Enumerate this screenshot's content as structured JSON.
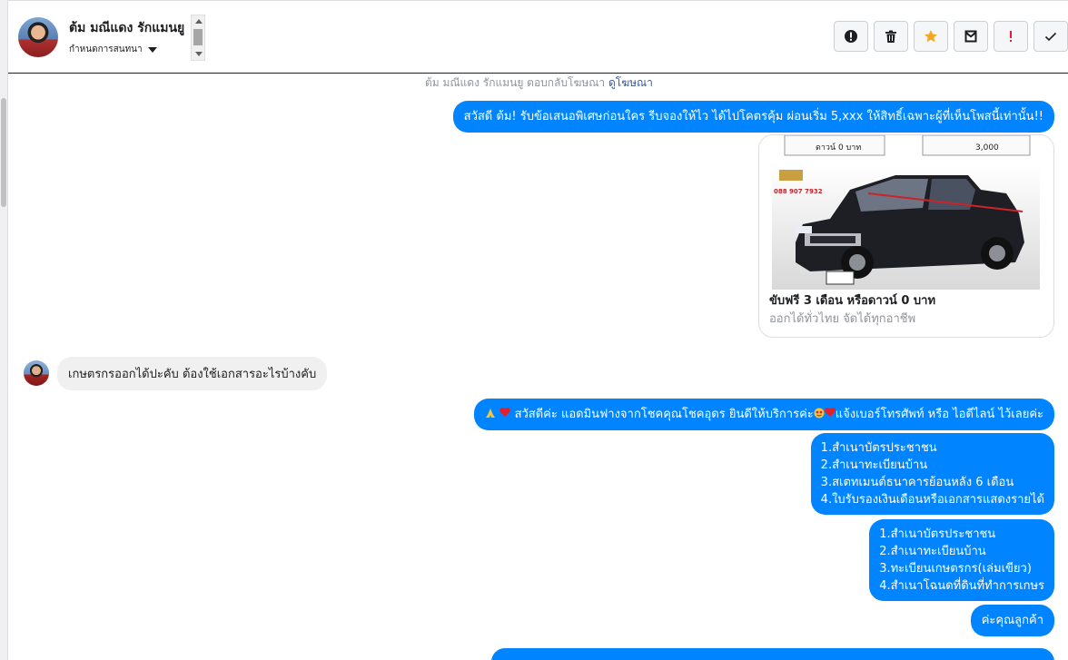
{
  "header": {
    "contact_name": "ต้ม มณีแดง รักแมนยู",
    "assign_label": "กำหนดการสนทนา",
    "toolbar": [
      {
        "icon": "exclamation-circle-icon",
        "label": "!"
      },
      {
        "icon": "trash-icon"
      },
      {
        "icon": "star-icon",
        "color": "#f5a623"
      },
      {
        "icon": "mark-unread-icon"
      },
      {
        "icon": "spam-icon",
        "label": "!",
        "color": "#e41e3f"
      },
      {
        "icon": "check-icon"
      }
    ]
  },
  "chat": {
    "ad_note": {
      "text": "ต้ม มณีแดง รักแมนยู ตอบกลับโฆษณา",
      "link": "ดูโฆษณา"
    },
    "messages": {
      "m1": "สวัสดี ต้ม! รับข้อเสนอพิเศษก่อนใคร รีบจองให้ไว ได้ไปโคตรคุ้ม ผ่อนเริ่ม 5,xxx  ให้สิทธิ์เฉพาะผู้ที่เห็นโพสนี้เท่านั้น!!",
      "card_title": "ขับฟรี 3 เดือน หรือดาวน์ 0 บาท",
      "card_subtitle": "ออกได้ทั่วไทย จัดได้ทุกอาชีพ",
      "card_img_text_1": "ดาวน์ 0 บาท",
      "card_img_text_2": "3,000",
      "card_img_phone": "088 907 7932",
      "m2": "เกษตรกรออกได้ปะคับ ต้องใช้เอกสารอะไรบ้างคับ",
      "m3_part1": "สวัสดีค่ะ แอดมินฟางจากโชคคุณโชคอุดร ยินดีให้บริการค่ะ",
      "m3_part2": "แจ้งเบอร์โทรศัพท์ หรือ ไอดีไลน์  ไว้เลยค่ะ",
      "list1": [
        "1.สำเนาบัตรประชาชน",
        "2.สำเนาทะเบียนบ้าน",
        "3.สเตทเมนต์ธนาคารย้อนหลัง 6 เดือน",
        "4.ใบรับรองเงินเดือนหรือเอกสารแสดงรายได้"
      ],
      "list2": [
        "1.สำเนาบัตรประชาชน",
        "2.สำเนาทะเบียนบ้าน",
        "3.ทะเบียนเกษตรกร(เล่มเขียว)",
        "4.สำเนาโฉนดที่ดินที่ทำการเกษร"
      ],
      "m4": "ค่ะคุณลูกค้า"
    }
  },
  "colors": {
    "outgoing": "#0084ff",
    "incoming": "#f1f0f0",
    "link": "#365899"
  }
}
